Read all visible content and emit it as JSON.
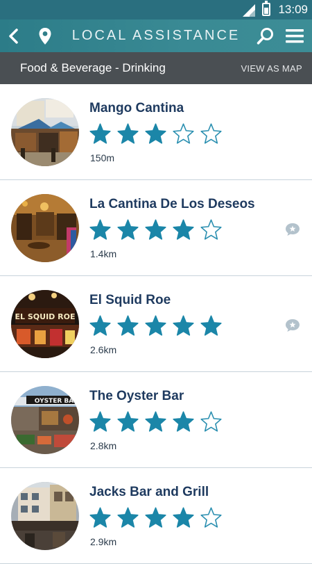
{
  "status": {
    "time": "13:09"
  },
  "header": {
    "title": "LOCAL ASSISTANCE"
  },
  "subheader": {
    "category": "Food & Beverage - Drinking",
    "map_link": "VIEW AS MAP"
  },
  "colors": {
    "star_fill": "#1b86a8",
    "star_empty": "#2a8fb0",
    "title": "#1e3a5f",
    "review_icon": "#b3c2cc"
  },
  "listings": [
    {
      "name": "Mango Cantina",
      "rating": 3,
      "distance": "150m",
      "has_reviews": false,
      "photo": "mango"
    },
    {
      "name": "La Cantina De Los Deseos",
      "rating": 4,
      "distance": "1.4km",
      "has_reviews": true,
      "photo": "cantina"
    },
    {
      "name": "El Squid Roe",
      "rating": 5,
      "distance": "2.6km",
      "has_reviews": true,
      "photo": "squid",
      "sign_text": "EL SQUID ROE"
    },
    {
      "name": "The Oyster Bar",
      "rating": 4,
      "distance": "2.8km",
      "has_reviews": false,
      "photo": "oyster",
      "sign_text": "OYSTER BA"
    },
    {
      "name": "Jacks Bar and Grill",
      "rating": 4,
      "distance": "2.9km",
      "has_reviews": false,
      "photo": "jacks"
    }
  ]
}
